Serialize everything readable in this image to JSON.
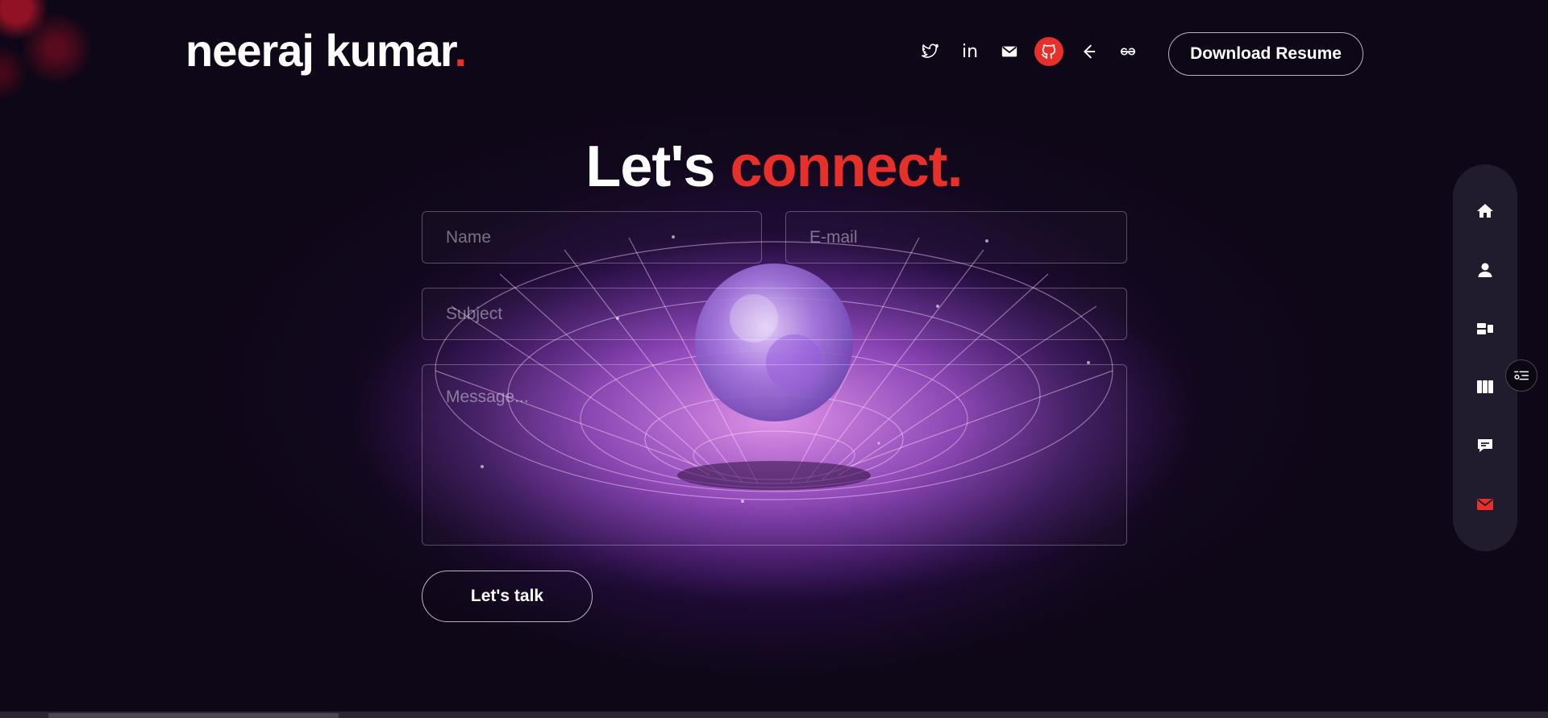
{
  "header": {
    "logo_text": "neeraj kumar",
    "logo_dot": ".",
    "social_icons": [
      "twitter-icon",
      "linkedin-icon",
      "mail-icon",
      "github-icon",
      "leetcode-icon",
      "geeksforgeeks-icon"
    ],
    "linkedin_label": "in",
    "resume_button_label": "Download Resume"
  },
  "main": {
    "heading_plain": "Let's ",
    "heading_accent": "connect.",
    "form": {
      "name_placeholder": "Name",
      "email_placeholder": "E-mail",
      "subject_placeholder": "Subject",
      "message_placeholder": "Message...",
      "submit_label": "Let's talk"
    }
  },
  "side_nav": {
    "items": [
      "home-icon",
      "about-icon",
      "projects-icon",
      "skills-icon",
      "testimonials-icon",
      "contact-icon"
    ],
    "active": "contact-icon"
  },
  "colors": {
    "background": "#0e0717",
    "accent": "#e8302a",
    "glow": "#c85af0",
    "side_nav_bg": "#211b2e"
  }
}
